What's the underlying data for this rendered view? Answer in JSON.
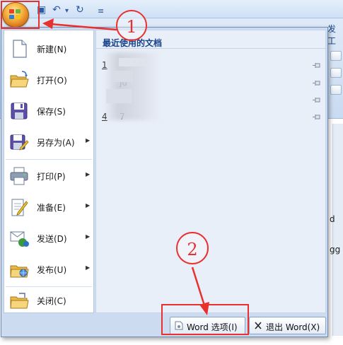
{
  "qat": {
    "save_glyph": "▣",
    "undo_glyph": "↶",
    "dropdown_glyph": "▾",
    "redo_glyph": "↻",
    "customize_glyph": "≡"
  },
  "ribbon": {
    "tab_label": "发工"
  },
  "document": {
    "text_d": "d",
    "text_gg": "gg"
  },
  "menu": {
    "commands": [
      {
        "label": "新建(N)",
        "icon": "new-document-icon",
        "submenu": false
      },
      {
        "label": "打开(O)",
        "icon": "open-folder-icon",
        "submenu": false
      },
      {
        "label": "保存(S)",
        "icon": "save-disk-icon",
        "submenu": false
      },
      {
        "label": "另存为(A)",
        "icon": "save-as-icon",
        "submenu": true
      },
      {
        "label": "打印(P)",
        "icon": "printer-icon",
        "submenu": true
      },
      {
        "label": "准备(E)",
        "icon": "prepare-document-icon",
        "submenu": true
      },
      {
        "label": "发送(D)",
        "icon": "send-icon",
        "submenu": true
      },
      {
        "label": "发布(U)",
        "icon": "publish-icon",
        "submenu": true
      },
      {
        "label": "关闭(C)",
        "icon": "close-document-icon",
        "submenu": false
      }
    ],
    "submenu_arrow": "▶",
    "recent_title": "最近使用的文档",
    "recent_docs": [
      {
        "num": "1",
        "name": ""
      },
      {
        "num": "",
        "name": "ju"
      },
      {
        "num": "",
        "name": ""
      },
      {
        "num": "4",
        "name": "7"
      }
    ],
    "word_options_label": "Word 选项(I)",
    "exit_word_label": "退出 Word(X)"
  },
  "annotations": {
    "step1": "1",
    "step2": "2",
    "color": "#e8312f"
  }
}
